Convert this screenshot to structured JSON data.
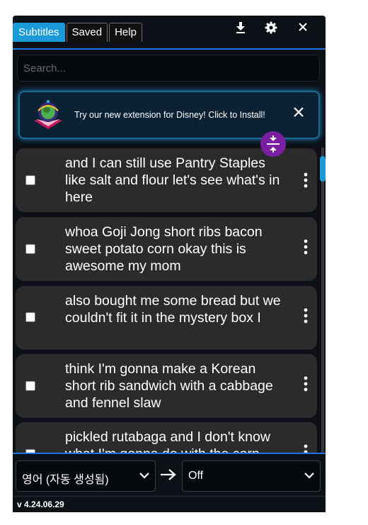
{
  "tabs": [
    {
      "label": "Subtitles",
      "active": true
    },
    {
      "label": "Saved",
      "active": false
    },
    {
      "label": "Help",
      "active": false
    }
  ],
  "header_icons": [
    "download-icon",
    "gear-icon",
    "close-icon"
  ],
  "search": {
    "placeholder": "Search..."
  },
  "banner": {
    "text": "Try our new extension for Disney! Click to Install!"
  },
  "subtitles": [
    {
      "text": "and I can still use Pantry Staples like salt and flour let's see what's in here",
      "checked": false
    },
    {
      "text": "whoa Goji Jong short ribs bacon sweet potato corn okay this is awesome my mom",
      "checked": false
    },
    {
      "text": "also bought me some bread but we couldn't fit it in the mystery box I",
      "checked": false
    },
    {
      "text": "think I'm gonna make a Korean short rib sandwich with a cabbage and fennel slaw",
      "checked": false
    },
    {
      "text": "pickled rutabaga and I don't know what I'm gonna do with the corn",
      "checked": false
    }
  ],
  "language": {
    "source": "영어 (자동 생성됨)",
    "target": "Off"
  },
  "version": "v 4.24.06.29",
  "colors": {
    "accent": "#1a9bd7",
    "divider": "#1a73e8",
    "compress": "#7b1fa2",
    "card": "#2b2b2b"
  }
}
